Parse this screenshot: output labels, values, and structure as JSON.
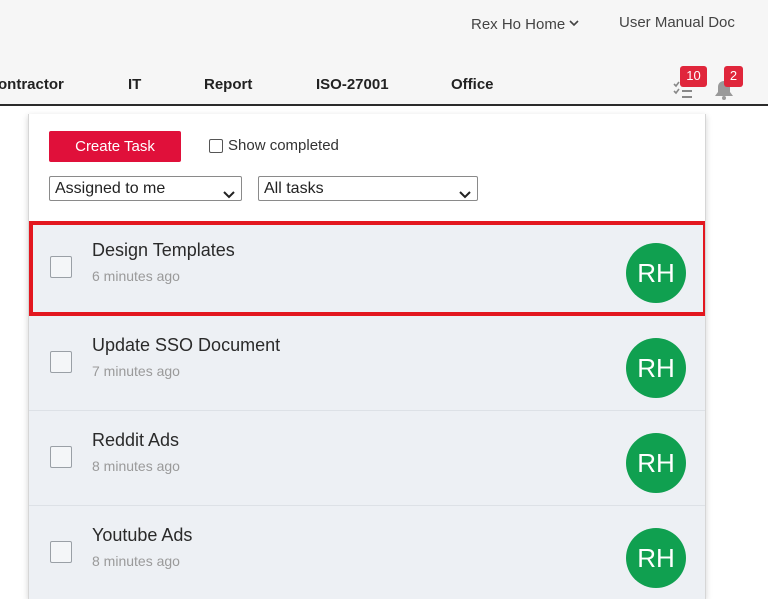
{
  "header": {
    "home_label": "Rex Ho Home",
    "manual_label": "User Manual Doc"
  },
  "nav": {
    "tabs": [
      {
        "label": "ontractor"
      },
      {
        "label": "IT"
      },
      {
        "label": "Report"
      },
      {
        "label": "ISO-27001"
      },
      {
        "label": "Office"
      }
    ],
    "tasks_badge": "10",
    "notifications_badge": "2"
  },
  "panel": {
    "create_label": "Create Task",
    "show_completed_label": "Show completed",
    "assign_filter": "Assigned to me",
    "task_filter": "All tasks",
    "tasks": [
      {
        "title": "Design Templates",
        "time": "6 minutes ago",
        "initials": "RH"
      },
      {
        "title": "Update SSO Document",
        "time": "7 minutes ago",
        "initials": "RH"
      },
      {
        "title": "Reddit Ads",
        "time": "8 minutes ago",
        "initials": "RH"
      },
      {
        "title": "Youtube Ads",
        "time": "8 minutes ago",
        "initials": "RH"
      }
    ]
  },
  "colors": {
    "brand_red": "#e0103a",
    "badge_red": "#e0263b",
    "avatar_green": "#10a050",
    "highlight": "#e3171f"
  }
}
